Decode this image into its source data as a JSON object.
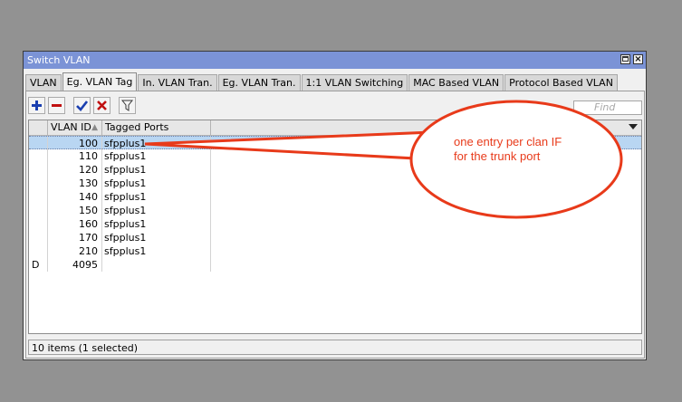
{
  "window": {
    "title": "Switch VLAN"
  },
  "tabs": [
    {
      "label": "VLAN",
      "active": false
    },
    {
      "label": "Eg. VLAN Tag",
      "active": true
    },
    {
      "label": "In. VLAN Tran.",
      "active": false
    },
    {
      "label": "Eg. VLAN Tran.",
      "active": false
    },
    {
      "label": "1:1 VLAN Switching",
      "active": false
    },
    {
      "label": "MAC Based VLAN",
      "active": false
    },
    {
      "label": "Protocol Based VLAN",
      "active": false
    }
  ],
  "toolbar": {
    "add_icon": "plus-icon",
    "remove_icon": "minus-icon",
    "enable_icon": "check-icon",
    "disable_icon": "x-icon",
    "filter_icon": "filter-icon",
    "find_placeholder": "Find"
  },
  "table": {
    "columns": [
      "VLAN ID",
      "Tagged Ports"
    ],
    "rows": [
      {
        "flag": "",
        "vlan_id": "100",
        "tagged_ports": "sfpplus1",
        "selected": true
      },
      {
        "flag": "",
        "vlan_id": "110",
        "tagged_ports": "sfpplus1"
      },
      {
        "flag": "",
        "vlan_id": "120",
        "tagged_ports": "sfpplus1"
      },
      {
        "flag": "",
        "vlan_id": "130",
        "tagged_ports": "sfpplus1"
      },
      {
        "flag": "",
        "vlan_id": "140",
        "tagged_ports": "sfpplus1"
      },
      {
        "flag": "",
        "vlan_id": "150",
        "tagged_ports": "sfpplus1"
      },
      {
        "flag": "",
        "vlan_id": "160",
        "tagged_ports": "sfpplus1"
      },
      {
        "flag": "",
        "vlan_id": "170",
        "tagged_ports": "sfpplus1"
      },
      {
        "flag": "",
        "vlan_id": "210",
        "tagged_ports": "sfpplus1"
      },
      {
        "flag": "D",
        "vlan_id": "4095",
        "tagged_ports": ""
      }
    ]
  },
  "status_text": "10 items (1 selected)",
  "annotation": {
    "line1": "one entry per clan IF",
    "line2": "for the trunk port",
    "color": "#e83a1a"
  },
  "colors": {
    "titlebar": "#7b93d6",
    "selection": "#b9d6f2",
    "desktop": "#929292"
  }
}
